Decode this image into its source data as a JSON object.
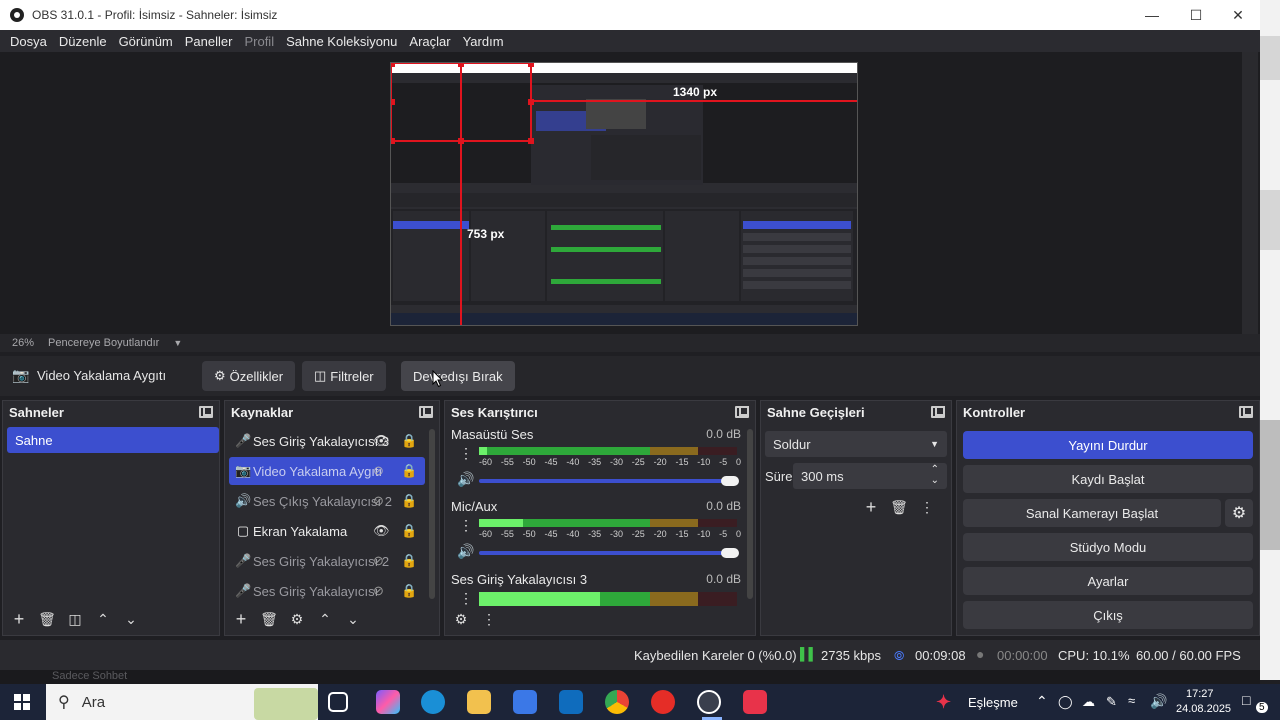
{
  "window": {
    "title": "OBS 31.0.1 - Profil: İsimsiz - Sahneler: İsimsiz"
  },
  "menu": [
    "Dosya",
    "Düzenle",
    "Görünüm",
    "Paneller",
    "Profil",
    "Sahne Koleksiyonu",
    "Araçlar",
    "Yardım"
  ],
  "preview": {
    "measure_width": "1340 px",
    "measure_height": "753 px",
    "zoom": "26%",
    "scale_mode": "Pencereye Boyutlandır"
  },
  "toolbar": {
    "source_name": "Video Yakalama Aygıtı",
    "properties": "Özellikler",
    "filters": "Filtreler",
    "deactivate": "Devredışı Bırak"
  },
  "scenes": {
    "title": "Sahneler",
    "items": [
      "Sahne"
    ]
  },
  "sources": {
    "title": "Kaynaklar",
    "items": [
      {
        "label": "Ses Giriş Yakalayıcısı 3",
        "icon": "mic-icon",
        "visible": true,
        "selected": false
      },
      {
        "label": "Video Yakalama Aygıtı",
        "icon": "camera-icon",
        "visible": false,
        "selected": true
      },
      {
        "label": "Ses Çıkış Yakalayıcısı 2",
        "icon": "speaker-icon",
        "visible": false,
        "selected": false
      },
      {
        "label": "Ekran Yakalama",
        "icon": "monitor-icon",
        "visible": true,
        "selected": false
      },
      {
        "label": "Ses Giriş Yakalayıcısı 2",
        "icon": "mic-icon",
        "visible": false,
        "selected": false
      },
      {
        "label": "Ses Giriş Yakalayıcısı",
        "icon": "mic-icon",
        "visible": false,
        "selected": false
      }
    ]
  },
  "mixer": {
    "title": "Ses Karıştırıcı",
    "scale": [
      "-60",
      "-55",
      "-50",
      "-45",
      "-40",
      "-35",
      "-30",
      "-25",
      "-20",
      "-15",
      "-10",
      "-5",
      "0"
    ],
    "channels": [
      {
        "name": "Masaüstü Ses",
        "db": "0.0 dB",
        "level": 0.03
      },
      {
        "name": "Mic/Aux",
        "db": "0.0 dB",
        "level": 0.17
      },
      {
        "name": "Ses Giriş Yakalayıcısı 3",
        "db": "0.0 dB",
        "level": 0.47
      }
    ]
  },
  "transitions": {
    "title": "Sahne Geçişleri",
    "type": "Soldur",
    "duration_label": "Süre",
    "duration": "300 ms"
  },
  "controls": {
    "title": "Kontroller",
    "stop_stream": "Yayını Durdur",
    "start_recording": "Kaydı Başlat",
    "virtual_camera": "Sanal Kamerayı Başlat",
    "studio_mode": "Stüdyo Modu",
    "settings": "Ayarlar",
    "exit": "Çıkış"
  },
  "status": {
    "dropped_frames": "Kaybedilen Kareler 0 (%0.0)",
    "bitrate": "2735 kbps",
    "stream_time": "00:09:08",
    "record_time": "00:00:00",
    "cpu": "CPU: 10.1%",
    "fps": "60.00 / 60.00 FPS"
  },
  "behind_window_text": "Sadece Sohbet",
  "taskbar": {
    "search": "Ara",
    "pairing": "Eşleşme",
    "time": "17:27",
    "date": "24.08.2025",
    "notifications": "5"
  }
}
